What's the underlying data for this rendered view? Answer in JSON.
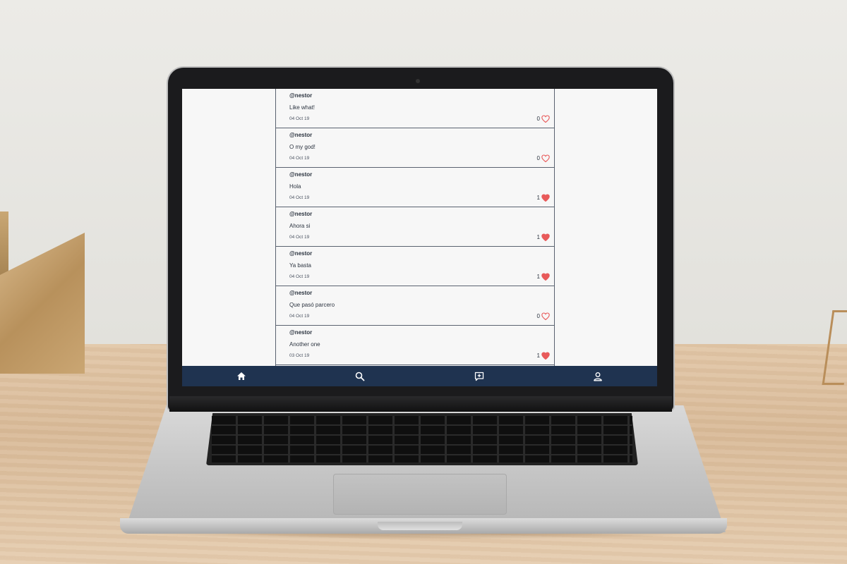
{
  "feed": {
    "posts": [
      {
        "user": "@nestor",
        "text": "Like what!",
        "date": "04 Oct 19",
        "likes": "0",
        "liked": false
      },
      {
        "user": "@nestor",
        "text": "O my god!",
        "date": "04 Oct 19",
        "likes": "0",
        "liked": false
      },
      {
        "user": "@nestor",
        "text": "Hola",
        "date": "04 Oct 19",
        "likes": "1",
        "liked": true
      },
      {
        "user": "@nestor",
        "text": "Ahora si",
        "date": "04 Oct 19",
        "likes": "1",
        "liked": true
      },
      {
        "user": "@nestor",
        "text": "Ya basta",
        "date": "04 Oct 19",
        "likes": "1",
        "liked": true
      },
      {
        "user": "@nestor",
        "text": "Que pasó parcero",
        "date": "04 Oct 19",
        "likes": "0",
        "liked": false
      },
      {
        "user": "@nestor",
        "text": "Another one",
        "date": "03 Oct 19",
        "likes": "1",
        "liked": true
      }
    ]
  },
  "navbar": {
    "items": [
      {
        "icon": "home-icon"
      },
      {
        "icon": "search-icon"
      },
      {
        "icon": "new-post-icon"
      },
      {
        "icon": "profile-icon"
      }
    ]
  },
  "colors": {
    "navbar": "#1f3350",
    "heart": "#e85a5a",
    "screen_bg": "#f7f7f7",
    "text": "#2c3440"
  }
}
